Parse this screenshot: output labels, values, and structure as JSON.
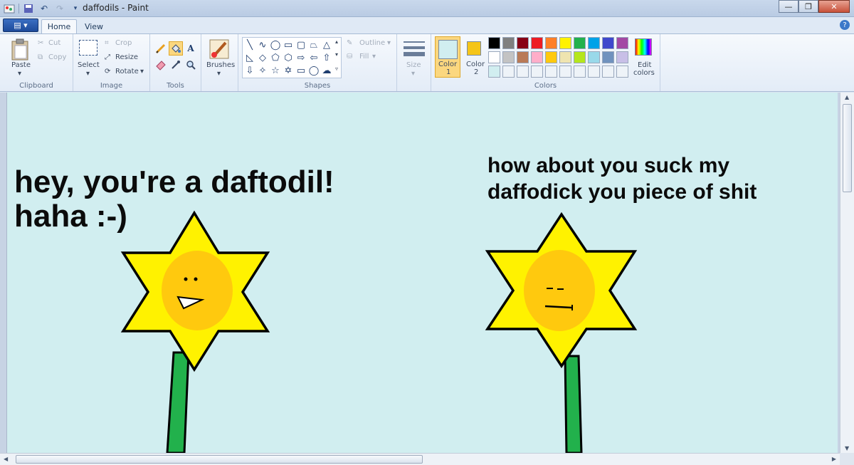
{
  "window": {
    "title": "daffodils - Paint"
  },
  "tabs": {
    "home": "Home",
    "view": "View"
  },
  "ribbon": {
    "clipboard": {
      "label": "Clipboard",
      "paste": "Paste",
      "cut": "Cut",
      "copy": "Copy"
    },
    "image": {
      "label": "Image",
      "select": "Select",
      "crop": "Crop",
      "resize": "Resize",
      "rotate": "Rotate"
    },
    "tools": {
      "label": "Tools"
    },
    "brushes": {
      "label": "Brushes"
    },
    "shapes": {
      "label": "Shapes",
      "outline": "Outline",
      "fill": "Fill"
    },
    "size": {
      "label": "Size"
    },
    "colors": {
      "label": "Colors",
      "color1_label": "Color",
      "color1_num": "1",
      "color2_label": "Color",
      "color2_num": "2",
      "edit": "Edit",
      "edit2": "colors",
      "color1": "#d1eef0",
      "color2": "#f5c518",
      "palette_row1": [
        "#000000",
        "#7f7f7f",
        "#880015",
        "#ed1c24",
        "#ff7f27",
        "#fff200",
        "#22b14c",
        "#00a2e8",
        "#3f48cc",
        "#a349a4"
      ],
      "palette_row2": [
        "#ffffff",
        "#c3c3c3",
        "#b97a57",
        "#ffaec9",
        "#ffc90e",
        "#efe4b0",
        "#b5e61d",
        "#99d9ea",
        "#7092be",
        "#c8bfe7"
      ],
      "palette_row3": [
        "#d1eef0",
        "#eef3f8",
        "#eef3f8",
        "#eef3f8",
        "#eef3f8",
        "#eef3f8",
        "#eef3f8",
        "#eef3f8",
        "#eef3f8",
        "#eef3f8"
      ]
    }
  },
  "canvas": {
    "left_line1": "hey, you're a daftodil!",
    "left_line2": "haha :-)",
    "right_line1": "how about you suck my",
    "right_line2": "daffodick you piece of shit"
  }
}
